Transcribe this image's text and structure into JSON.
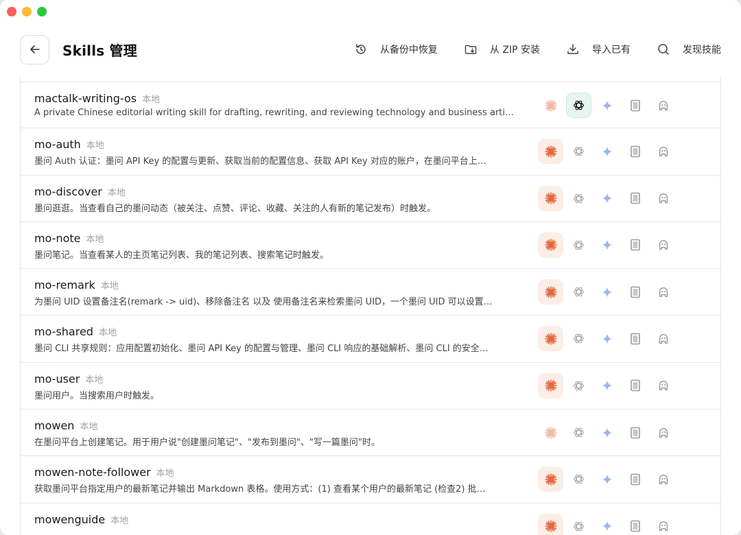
{
  "header": {
    "title": "Skills 管理",
    "actions": [
      {
        "label": "从备份中恢复",
        "icon": "history-icon"
      },
      {
        "label": "从 ZIP 安装",
        "icon": "folder-zip-icon"
      },
      {
        "label": "导入已有",
        "icon": "download-icon"
      },
      {
        "label": "发现技能",
        "icon": "search-icon"
      }
    ]
  },
  "agent_icons": [
    "claude-icon",
    "openai-icon",
    "gemini-icon",
    "tablet-icon",
    "agent-avatar-icon"
  ],
  "colors": {
    "claude": "#e0693f",
    "claude_bg": "#fbeee6",
    "openai_bg": "#e7f5f0",
    "gemini": "#6f9be6"
  },
  "skills": [
    {
      "name": "mactalk-writing-os",
      "tag": "本地",
      "desc": "A private Chinese editorial writing skill for drafting, rewriting, and reviewing technology and business arti…",
      "claude": false,
      "openai": true
    },
    {
      "name": "mo-auth",
      "tag": "本地",
      "desc": "墨问 Auth 认证：墨问 API Key 的配置与更新、获取当前的配置信息、获取 API Key 对应的账户，在墨问平台上…",
      "claude": true,
      "openai": false
    },
    {
      "name": "mo-discover",
      "tag": "本地",
      "desc": "墨问逛逛。当查看自己的墨问动态（被关注、点赞、评论、收藏、关注的人有新的笔记发布）时触发。",
      "claude": true,
      "openai": false
    },
    {
      "name": "mo-note",
      "tag": "本地",
      "desc": "墨问笔记。当查看某人的主页笔记列表、我的笔记列表、搜索笔记时触发。",
      "claude": true,
      "openai": false
    },
    {
      "name": "mo-remark",
      "tag": "本地",
      "desc": "为墨问 UID 设置备注名(remark -> uid)、移除备注名 以及 使用备注名来检索墨问 UID，一个墨问 UID 可以设置…",
      "claude": true,
      "openai": false
    },
    {
      "name": "mo-shared",
      "tag": "本地",
      "desc": "墨问 CLI 共享规则：应用配置初始化、墨问 API Key 的配置与管理、墨问 CLI 响应的基础解析、墨问 CLI 的安全…",
      "claude": true,
      "openai": false
    },
    {
      "name": "mo-user",
      "tag": "本地",
      "desc": "墨问用户。当搜索用户时触发。",
      "claude": true,
      "openai": false
    },
    {
      "name": "mowen",
      "tag": "本地",
      "desc": "在墨问平台上创建笔记。用于用户说\"创建墨问笔记\"、\"发布到墨问\"、\"写一篇墨问\"时。",
      "claude": false,
      "openai": false
    },
    {
      "name": "mowen-note-follower",
      "tag": "本地",
      "desc": "获取墨问平台指定用户的最新笔记并输出 Markdown 表格。使用方式：(1) 查看某个用户的最新笔记 (检查2) 批…",
      "claude": true,
      "openai": false
    },
    {
      "name": "mowenguide",
      "tag": "本地",
      "desc": "",
      "claude": true,
      "openai": false
    }
  ]
}
